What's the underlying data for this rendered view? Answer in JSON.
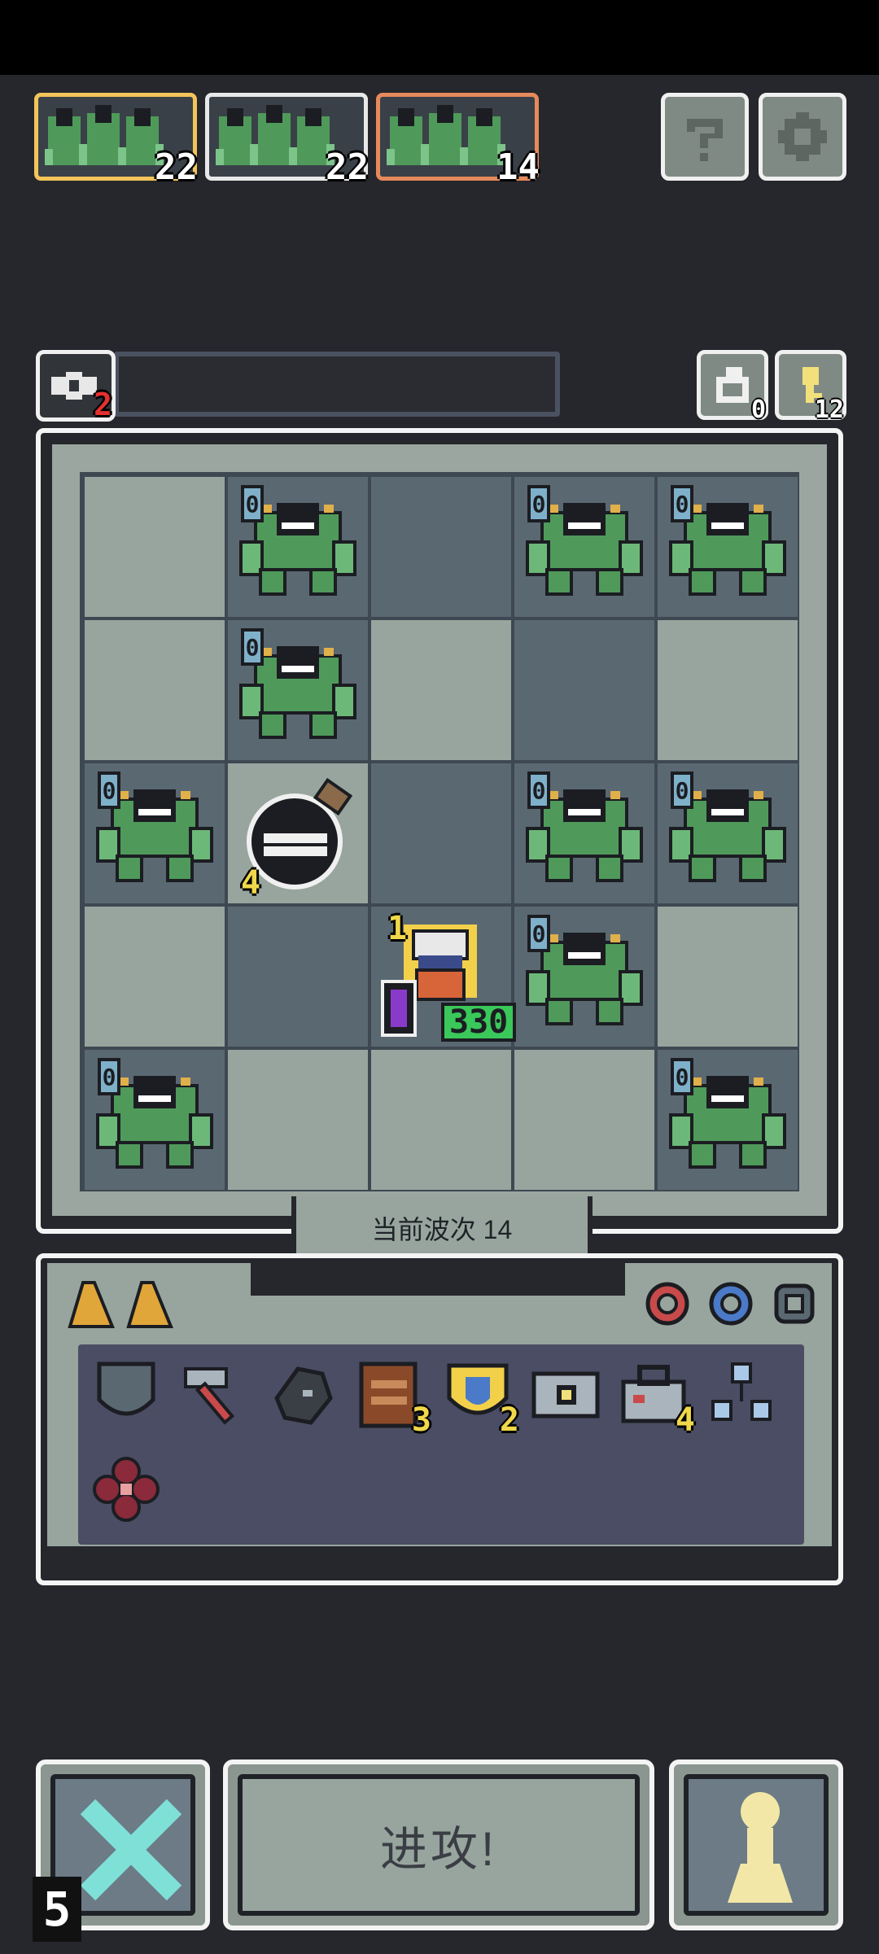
{
  "queue": [
    {
      "count": "22",
      "border": "#f2c45a"
    },
    {
      "count": "22",
      "border": "#e8e8e8"
    },
    {
      "count": "14",
      "border": "#e58a5a"
    }
  ],
  "top_buttons": {
    "help_icon": "question-icon",
    "settings_icon": "gear-icon"
  },
  "status": {
    "eye_count": "2"
  },
  "resources": {
    "rotate_count": "0",
    "key_count": "12"
  },
  "board": {
    "wave_label": "当前波次 14",
    "cells": [
      [
        "light-empty",
        "dark-mob",
        "dark-empty",
        "dark-mob",
        "dark-mob"
      ],
      [
        "light-empty",
        "dark-mob",
        "light-empty",
        "dark-empty",
        "light-empty"
      ],
      [
        "dark-mob",
        "light-potion",
        "dark-empty",
        "dark-mob",
        "dark-mob"
      ],
      [
        "light-empty",
        "dark-empty",
        "dark-hero",
        "dark-mob",
        "light-empty"
      ],
      [
        "dark-mob",
        "light-empty",
        "light-empty",
        "light-empty",
        "dark-mob"
      ]
    ],
    "mob_level": "0",
    "potion_count": "4",
    "hero": {
      "level": "1",
      "hp": "330"
    }
  },
  "inventory": {
    "tab_items": [
      "cheese-wedge-icon",
      "cheese-wedge-icon"
    ],
    "side_icons": [
      "red-ring-icon",
      "blue-ring-icon",
      "armor-ring-icon"
    ],
    "items": [
      {
        "icon": "shield-icon",
        "count": ""
      },
      {
        "icon": "hammer-icon",
        "count": ""
      },
      {
        "icon": "crow-icon",
        "count": ""
      },
      {
        "icon": "spellbook-icon",
        "count": "3"
      },
      {
        "icon": "crest-icon",
        "count": "2"
      },
      {
        "icon": "camera-icon",
        "count": ""
      },
      {
        "icon": "toolbox-icon",
        "count": "4"
      },
      {
        "icon": "network-icon",
        "count": ""
      },
      {
        "icon": "flower-icon",
        "count": ""
      }
    ]
  },
  "controls": {
    "attack_label": "进攻!",
    "skip_count": "5"
  }
}
